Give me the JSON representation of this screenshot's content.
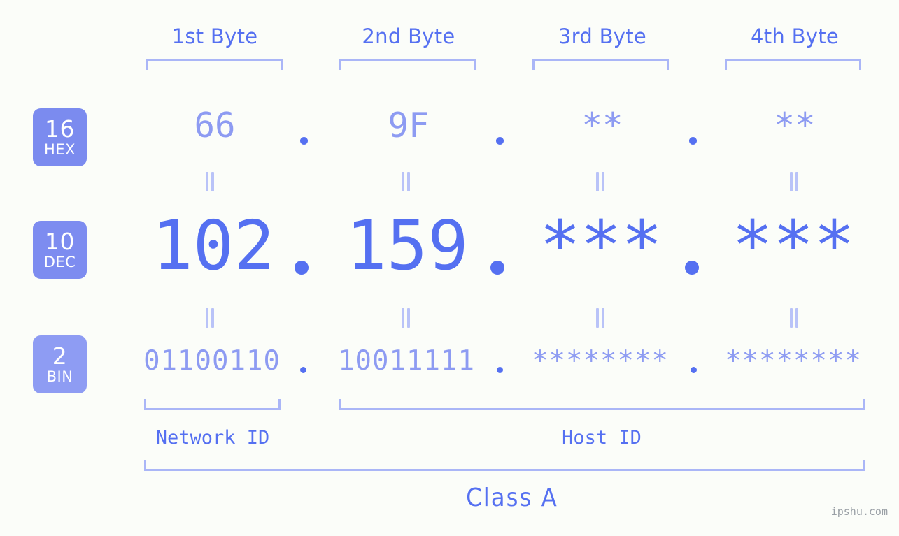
{
  "theme": {
    "background": "#fbfdf9",
    "accent_strong": "#5570f1",
    "accent_light": "#8d9bf2",
    "bracket": "#aab6f7",
    "badge_hex": "#7b8bef",
    "badge_dec": "#7d8cf0",
    "badge_bin": "#8e9cf3",
    "watermark": "#9aa0a6"
  },
  "headers": [
    {
      "label": "1st Byte"
    },
    {
      "label": "2nd Byte"
    },
    {
      "label": "3rd Byte"
    },
    {
      "label": "4th Byte"
    }
  ],
  "rows": [
    {
      "key": "hex",
      "badge_num": "16",
      "badge_label": "HEX",
      "values": [
        "66",
        "9F",
        "**",
        "**"
      ],
      "separator": "."
    },
    {
      "key": "dec",
      "badge_num": "10",
      "badge_label": "DEC",
      "values": [
        "102",
        "159",
        "***",
        "***"
      ],
      "separator": "."
    },
    {
      "key": "bin",
      "badge_num": "2",
      "badge_label": "BIN",
      "values": [
        "01100110",
        "10011111",
        "********",
        "********"
      ],
      "separator": "."
    }
  ],
  "equivalence_symbol": "=",
  "sections": [
    {
      "label": "Network ID"
    },
    {
      "label": "Host ID"
    }
  ],
  "class": {
    "label": "Class A"
  },
  "watermark": {
    "text": "ipshu.com"
  },
  "address": {
    "decimal": "102.159.***.***",
    "hex": "66.9F.**.**",
    "binary": "01100110.10011111.********.********"
  }
}
